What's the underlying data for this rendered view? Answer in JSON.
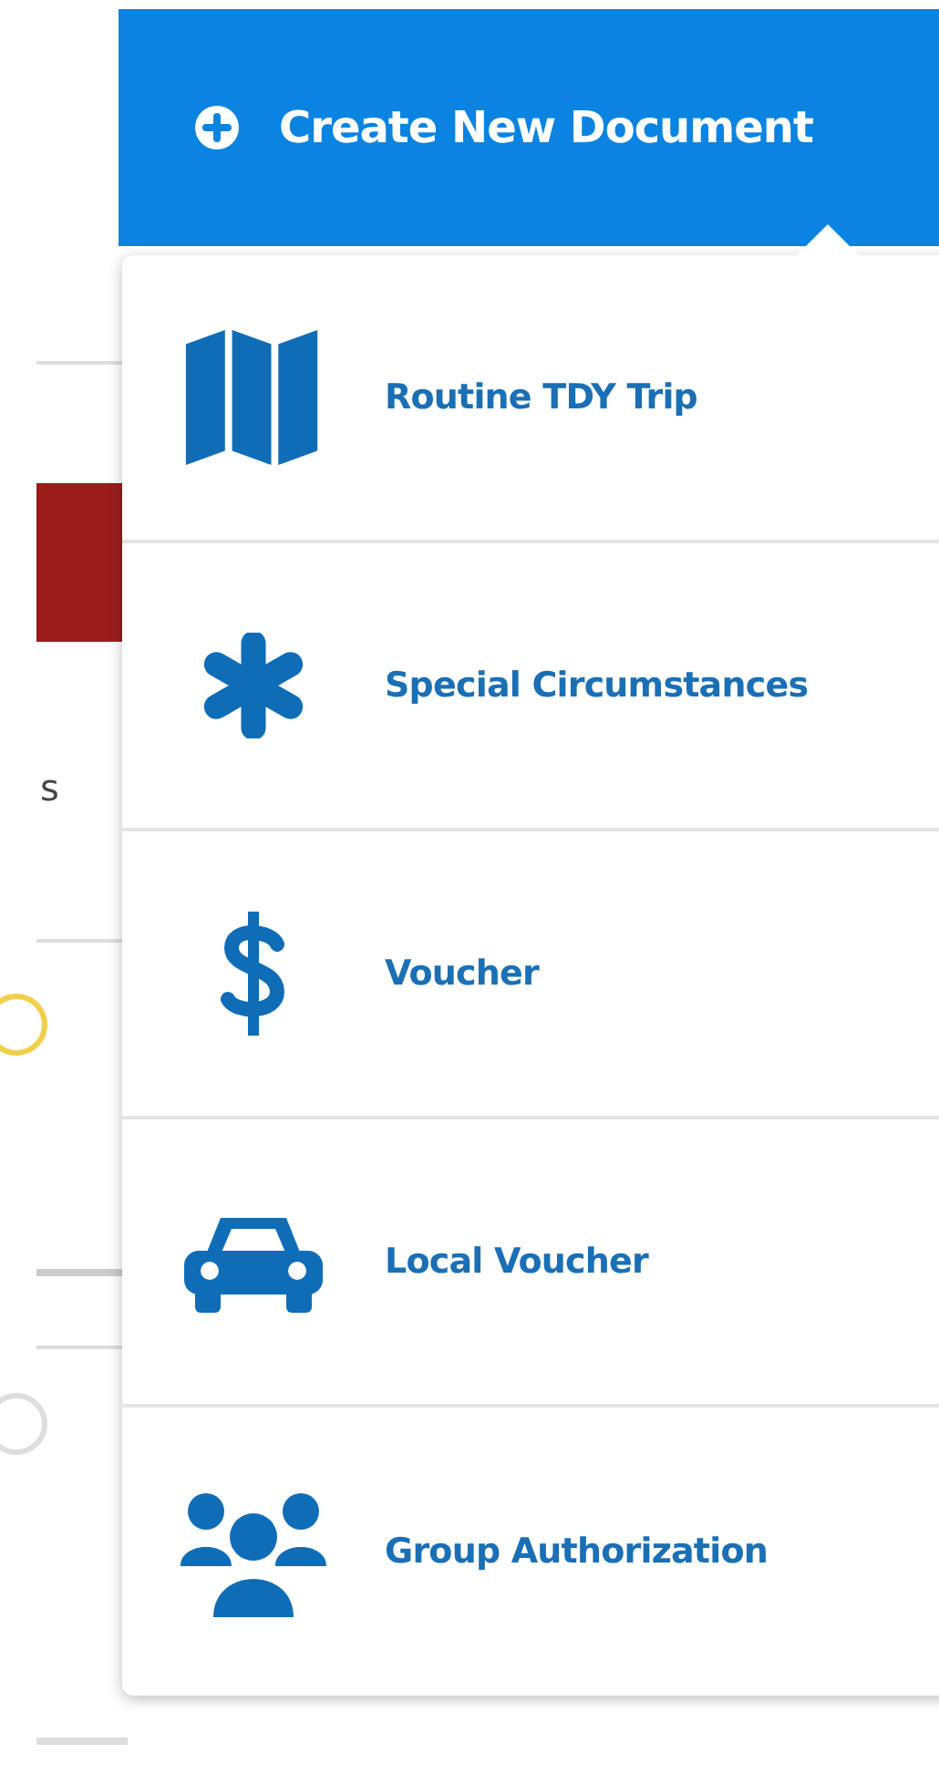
{
  "create_button": {
    "label": "Create New Document"
  },
  "menu": {
    "items": [
      {
        "label": "Routine TDY Trip"
      },
      {
        "label": "Special Circumstances"
      },
      {
        "label": "Voucher"
      },
      {
        "label": "Local Voucher"
      },
      {
        "label": "Group Authorization"
      }
    ]
  },
  "background": {
    "fragment_text": "s"
  }
}
